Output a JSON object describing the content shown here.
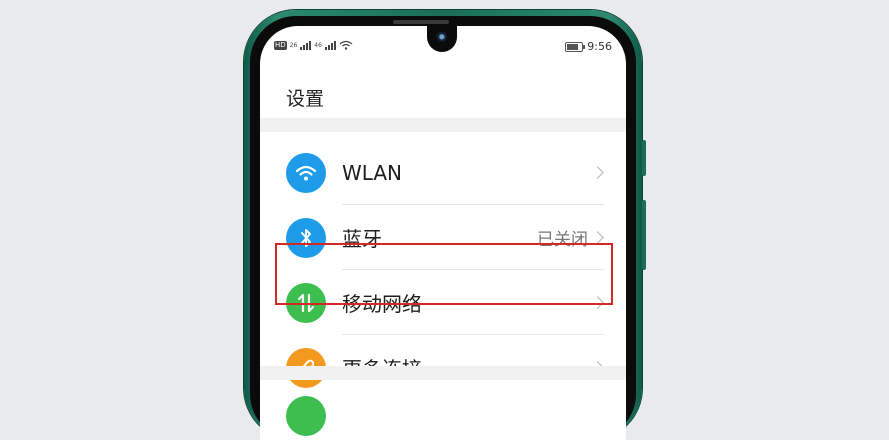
{
  "status_bar": {
    "left_icons": [
      "hd-icon",
      "signal-icon",
      "signal-icon",
      "wifi-icon"
    ],
    "network_1": "26",
    "network_2": "46",
    "time": "9:56",
    "battery_level": 0.8
  },
  "settings": {
    "title": "设置",
    "items": [
      {
        "label": "WLAN",
        "value": "",
        "icon": "wifi-icon",
        "color": "#1e9be9"
      },
      {
        "label": "蓝牙",
        "value": "已关闭",
        "icon": "bluetooth-icon",
        "color": "#1e9be9"
      },
      {
        "label": "移动网络",
        "value": "",
        "icon": "mobile-data-icon",
        "color": "#3cbf4f"
      },
      {
        "label": "更多连接",
        "value": "",
        "icon": "link-icon",
        "color": "#f39a1e"
      },
      {
        "label": "",
        "value": "",
        "icon": "",
        "color": "#3cbf4f"
      }
    ]
  },
  "colors": {
    "phone_frame": "#1b6e5a",
    "highlight": "#d42a26"
  }
}
